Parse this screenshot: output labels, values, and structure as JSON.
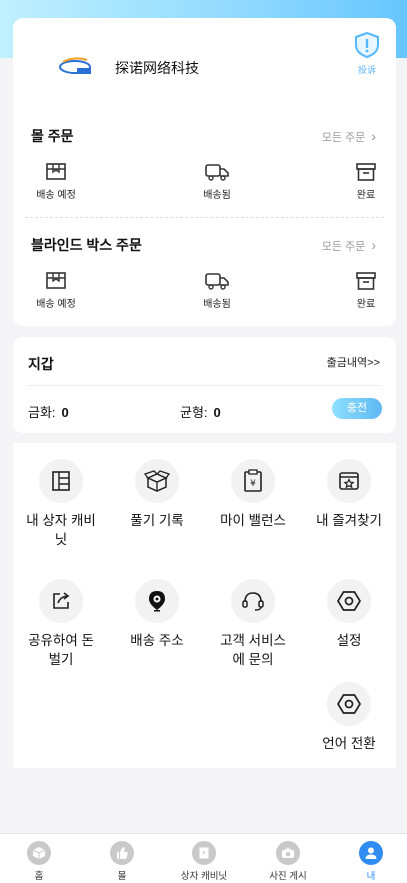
{
  "header": {
    "company_name": "探诺网络科技",
    "complain_label": "投诉"
  },
  "mall_orders": {
    "title": "몰 주문",
    "all_link": "모든 주문",
    "statuses": [
      {
        "label": "배송 예정",
        "icon": "package-icon"
      },
      {
        "label": "배송됨",
        "icon": "truck-icon"
      },
      {
        "label": "완료",
        "icon": "archive-box-icon"
      }
    ]
  },
  "blind_box_orders": {
    "title": "블라인드 박스 주문",
    "all_link": "모든 주문",
    "statuses": [
      {
        "label": "배송 예정",
        "icon": "package-icon"
      },
      {
        "label": "배송됨",
        "icon": "truck-icon"
      },
      {
        "label": "완료",
        "icon": "archive-box-icon"
      }
    ]
  },
  "wallet": {
    "title": "지갑",
    "withdraw_link": "출금내역>>",
    "gold_label": "금화:",
    "gold_value": "0",
    "balance_label": "균형:",
    "balance_value": "0",
    "charge_label": "충전"
  },
  "menu": {
    "items": [
      {
        "label": "내 상자 캐비닛",
        "icon": "cabinet-icon"
      },
      {
        "label": "풀기 기록",
        "icon": "open-box-icon"
      },
      {
        "label": "마이 밸런스",
        "icon": "balance-clipboard-icon"
      },
      {
        "label": "내 즐겨찾기",
        "icon": "favorites-icon"
      },
      {
        "label": "공유하여 돈 벌기",
        "icon": "share-icon"
      },
      {
        "label": "배송 주소",
        "icon": "location-pin-icon"
      },
      {
        "label": "고객 서비스에 문의",
        "icon": "headset-icon"
      },
      {
        "label": "설정",
        "icon": "settings-hex-icon"
      },
      {
        "label": "언어 전환",
        "icon": "language-hex-icon"
      }
    ]
  },
  "tabbar": {
    "tabs": [
      {
        "label": "홈",
        "icon": "cube-icon"
      },
      {
        "label": "몰",
        "icon": "thumbs-up-icon"
      },
      {
        "label": "상자 캐비닛",
        "icon": "cabinet-icon"
      },
      {
        "label": "사진 게시",
        "icon": "camera-icon"
      },
      {
        "label": "내",
        "icon": "user-icon"
      }
    ],
    "active_index": 4
  },
  "colors": {
    "accent": "#2f8cf0",
    "gradient_start": "#8ee0ff",
    "gradient_end": "#5fb8f5"
  }
}
